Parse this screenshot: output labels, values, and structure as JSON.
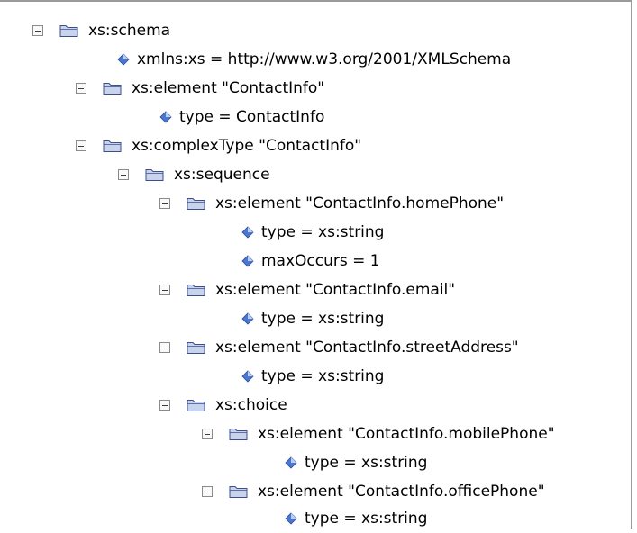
{
  "tree": {
    "nodes": [
      {
        "kind": "element",
        "label": "xs:schema"
      },
      {
        "kind": "attribute",
        "label": "xmlns:xs = http://www.w3.org/2001/XMLSchema"
      },
      {
        "kind": "element",
        "label": "xs:element \"ContactInfo\""
      },
      {
        "kind": "attribute",
        "label": "type = ContactInfo"
      },
      {
        "kind": "element",
        "label": "xs:complexType \"ContactInfo\""
      },
      {
        "kind": "element",
        "label": "xs:sequence"
      },
      {
        "kind": "element",
        "label": "xs:element \"ContactInfo.homePhone\""
      },
      {
        "kind": "attribute",
        "label": "type = xs:string"
      },
      {
        "kind": "attribute",
        "label": "maxOccurs = 1"
      },
      {
        "kind": "element",
        "label": "xs:element \"ContactInfo.email\""
      },
      {
        "kind": "attribute",
        "label": "type = xs:string"
      },
      {
        "kind": "element",
        "label": "xs:element \"ContactInfo.streetAddress\""
      },
      {
        "kind": "attribute",
        "label": "type = xs:string"
      },
      {
        "kind": "element",
        "label": "xs:choice"
      },
      {
        "kind": "element",
        "label": "xs:element \"ContactInfo.mobilePhone\""
      },
      {
        "kind": "attribute",
        "label": "type = xs:string"
      },
      {
        "kind": "element",
        "label": "xs:element \"ContactInfo.officePhone\""
      },
      {
        "kind": "attribute",
        "label": "type = xs:string"
      }
    ]
  },
  "colors": {
    "folder_fill": "#c9d3ec",
    "folder_edge": "#3b4f8e",
    "diamond_fill": "#4a78d0",
    "diamond_light": "#b9d0f4"
  },
  "icons": {
    "element": "folder-icon",
    "attribute": "attribute-diamond-icon",
    "toggle": "collapse-toggle-icon"
  }
}
